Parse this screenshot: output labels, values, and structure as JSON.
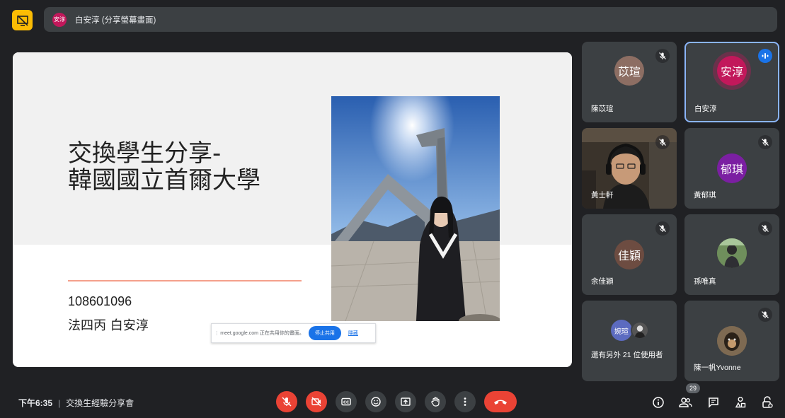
{
  "topbar": {
    "presenter_initials": "安淳",
    "presenter_text": "白安淳 (分享螢幕畫面)"
  },
  "slide": {
    "title": "交換學生分享-\n韓國國立首爾大學",
    "student_id": "108601096",
    "student_name": "法四丙 白安淳"
  },
  "share_bar": {
    "message": "meet.google.com 正在共用你的畫面。",
    "stop_label": "停止共用",
    "hide_label": "隱藏"
  },
  "participants": [
    {
      "name": "陳苡瑄",
      "initials": "苡瑄",
      "color": "#8d6e63",
      "muted": true
    },
    {
      "name": "白安淳",
      "initials": "安淳",
      "color": "#c2185b",
      "muted": false,
      "speaking": true
    },
    {
      "name": "黃士軒",
      "video": true,
      "muted": true
    },
    {
      "name": "黃郁琪",
      "initials": "郁琪",
      "color": "#7b1fa2",
      "muted": true
    },
    {
      "name": "余佳穎",
      "initials": "佳穎",
      "color": "#6d4c41",
      "muted": true
    },
    {
      "name": "孫唯真",
      "photo": true,
      "muted": true
    },
    {
      "name": "還有另外 21 位使用者",
      "initials": "婉瑄",
      "color": "#5c6bc0",
      "others": true
    },
    {
      "name": "陳一帆Yvonne",
      "photo": true,
      "muted": true
    }
  ],
  "bottombar": {
    "time": "下午6:35",
    "meeting_title": "交換生經驗分享會",
    "participant_count": "29"
  },
  "colors": {
    "background": "#202124",
    "tile": "#3c4043",
    "danger": "#ea4335",
    "accent": "#1a73e8",
    "presenting": "#fbbc04"
  },
  "icons": {
    "mic_off": "mic-off-icon",
    "cam_off": "camera-off-icon",
    "captions": "captions-icon",
    "emoji": "emoji-icon",
    "present": "present-icon",
    "hand": "raise-hand-icon",
    "more": "more-options-icon",
    "leave": "leave-call-icon",
    "info": "info-icon",
    "people": "people-icon",
    "chat": "chat-icon",
    "activities": "activities-icon",
    "host": "host-controls-icon"
  }
}
